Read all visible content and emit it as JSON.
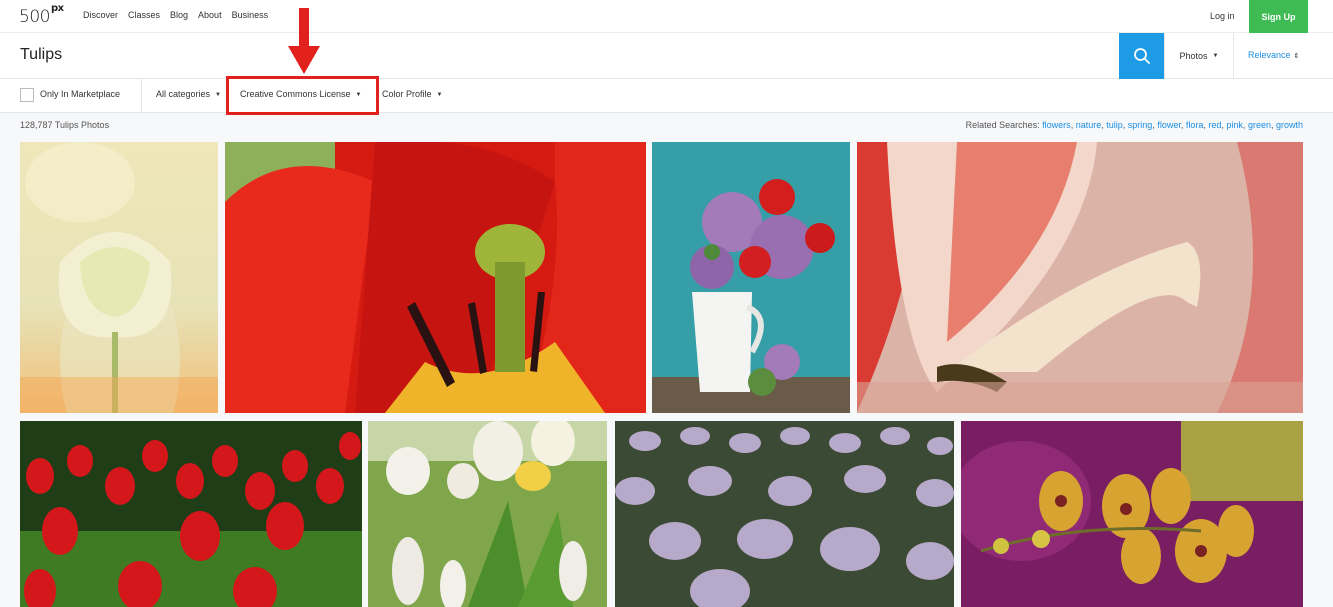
{
  "nav": {
    "logo": "500",
    "logo_sup": "px",
    "links": [
      "Discover",
      "Classes",
      "Blog",
      "About",
      "Business"
    ],
    "login": "Log in",
    "signup": "Sign Up"
  },
  "search": {
    "query": "Tulips",
    "type_select": "Photos",
    "sort_select": "Relevance",
    "accent_color": "#1d9ce5"
  },
  "filters": {
    "marketplace_label": "Only In Marketplace",
    "categories": "All categories",
    "license": "Creative Commons License",
    "color_profile": "Color Profile"
  },
  "results": {
    "count_text": "128,787 Tulips Photos",
    "related_label": "Related Searches:",
    "related_tags": [
      "flowers",
      "nature",
      "tulip",
      "spring",
      "flower",
      "flora",
      "red",
      "pink",
      "green",
      "growth"
    ]
  },
  "annotation": {
    "highlight_color": "#e2211c"
  },
  "photos": [
    {
      "subject": "pale yellow tulips"
    },
    {
      "subject": "red tulip close-up"
    },
    {
      "subject": "lilac and red tulips in white jug"
    },
    {
      "subject": "red and white tulip petal close-up"
    },
    {
      "subject": "red tulip field"
    },
    {
      "subject": "white tulips and grape hyacinths"
    },
    {
      "subject": "lavender tulip field"
    },
    {
      "subject": "yellow and purple orchids"
    }
  ]
}
